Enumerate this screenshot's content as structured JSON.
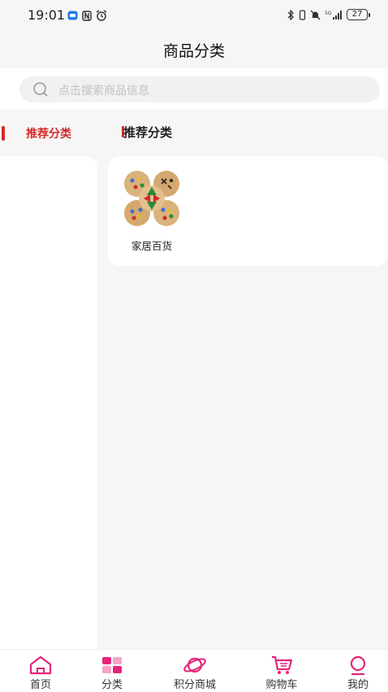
{
  "status_bar": {
    "time": "19:01",
    "battery_level": "27",
    "icons": [
      "message-icon",
      "nfc-icon",
      "alarm-icon",
      "bluetooth-icon",
      "vibrate-icon",
      "mute-icon",
      "signal-5g-icon",
      "battery-icon"
    ]
  },
  "header": {
    "title": "商品分类"
  },
  "search": {
    "placeholder": "点击搜索商品信息"
  },
  "sidebar": {
    "items": [
      {
        "label": "推荐分类",
        "selected": true
      }
    ]
  },
  "content": {
    "section_title": "推荐分类",
    "products": [
      {
        "name": "家居百货",
        "image": "chinese-checkers-board-image"
      }
    ]
  },
  "tabbar": {
    "items": [
      {
        "label": "首页",
        "icon": "home-icon"
      },
      {
        "label": "分类",
        "icon": "category-icon",
        "selected": true
      },
      {
        "label": "积分商城",
        "icon": "planet-icon"
      },
      {
        "label": "购物车",
        "icon": "cart-icon"
      },
      {
        "label": "我的",
        "icon": "profile-icon"
      }
    ]
  },
  "colors": {
    "accent": "#d32a2a",
    "brand_pink": "#e6247a",
    "background": "#f6f6f6"
  }
}
